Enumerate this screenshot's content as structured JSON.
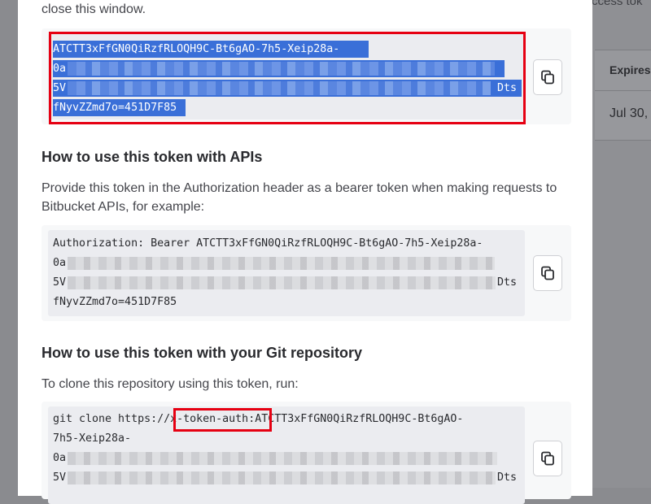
{
  "background": {
    "top_text": "ccess tok",
    "table_header": "Expires",
    "table_cell": "Jul 30,"
  },
  "modal": {
    "intro_text": "close this window.",
    "token_block": {
      "line1": "ATCTT3xFfGN0QiRzfRLOQH9C-Bt6gAO-7h5-Xeip28a-",
      "line2_start": "0a",
      "line3_start": "5V",
      "line3_end": "Dts",
      "line4": "fNyvZZmd7o=451D7F85",
      "selected": true
    },
    "api_section": {
      "title": "How to use this token with APIs",
      "description": "Provide this token in the Authorization header as a bearer token when making requests to Bitbucket APIs, for example:",
      "code": {
        "line1": "Authorization: Bearer ATCTT3xFfGN0QiRzfRLOQH9C-Bt6gAO-7h5-Xeip28a-",
        "line2_start": "0a",
        "line3_start": "5V",
        "line3_end": "Dts",
        "line4": "fNyvZZmd7o=451D7F85"
      }
    },
    "git_section": {
      "title": "How to use this token with your Git repository",
      "description": "To clone this repository using this token, run:",
      "code": {
        "line1_prefix": "git clone https://",
        "line1_user": "x-token-auth",
        "line1_suffix": ":ATCTT3xFfGN0QiRzfRLOQH9C-Bt6gAO-",
        "line2": "7h5-Xeip28a-",
        "line3_start": "0a",
        "line4_start": "5V",
        "line4_end": "Dts"
      }
    },
    "copy_button_icon": "copy-icon"
  },
  "annotations": {
    "highlight_color": "#e60012",
    "selection_color": "#3a6fd8"
  }
}
